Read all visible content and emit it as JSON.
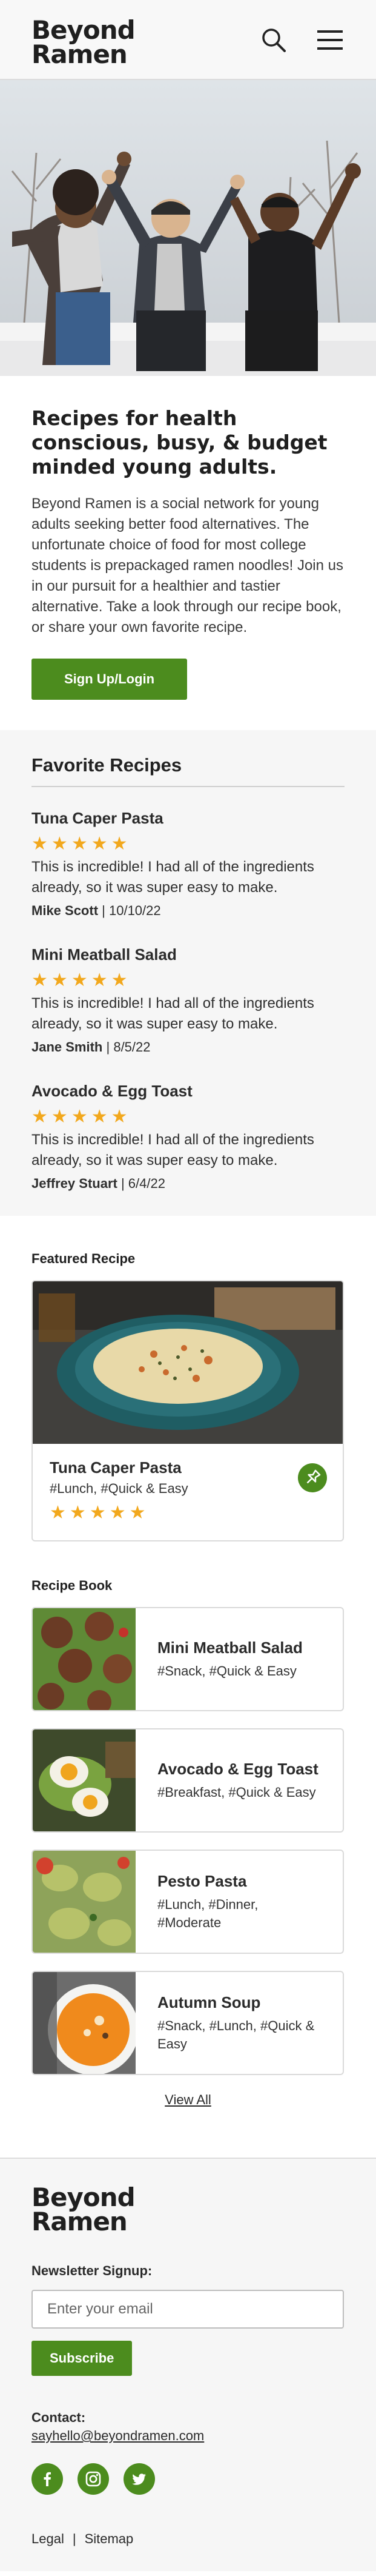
{
  "header": {
    "logo_line1": "Beyond",
    "logo_line2": "Ramen",
    "search_icon": "search-icon",
    "menu_icon": "hamburger-menu-icon"
  },
  "intro": {
    "heading": "Recipes for health conscious, busy, & budget minded young adults.",
    "body": "Beyond Ramen is a social network for young adults seeking better food alternatives. The unfortunate choice of food for most college students is prepackaged ramen noodles! Join us in our pursuit for a healthier and tastier alternative. Take a look through our recipe book, or share your own favorite recipe.",
    "cta_label": "Sign Up/Login"
  },
  "favorites": {
    "title": "Favorite Recipes",
    "reviews": [
      {
        "recipe": "Tuna Caper Pasta",
        "rating": 5,
        "text": "This is incredible! I had all of the ingredients already, so it was super easy to make.",
        "author": "Mike Scott",
        "date": "| 10/10/22"
      },
      {
        "recipe": "Mini Meatball Salad",
        "rating": 5,
        "text": "This is incredible! I had all of the ingredients already, so it was super easy to make.",
        "author": "Jane Smith",
        "date": "| 8/5/22"
      },
      {
        "recipe": "Avocado & Egg Toast",
        "rating": 5,
        "text": "This is incredible! I had all of the ingredients already, so it was super easy to make.",
        "author": "Jeffrey Stuart",
        "date": "| 6/4/22"
      }
    ]
  },
  "featured": {
    "title": "Featured Recipe",
    "name": "Tuna Caper Pasta",
    "tags": "#Lunch, #Quick & Easy",
    "rating": 5,
    "pin_icon": "pin-icon"
  },
  "book": {
    "title": "Recipe Book",
    "items": [
      {
        "name": "Mini Meatball Salad",
        "tags": "#Snack, #Quick & Easy"
      },
      {
        "name": "Avocado & Egg Toast",
        "tags": "#Breakfast, #Quick & Easy"
      },
      {
        "name": "Pesto Pasta",
        "tags": "#Lunch, #Dinner, #Moderate"
      },
      {
        "name": "Autumn Soup",
        "tags": "#Snack, #Lunch, #Quick & Easy"
      }
    ],
    "view_all": "View All"
  },
  "footer": {
    "logo_line1": "Beyond",
    "logo_line2": "Ramen",
    "newsletter_label": "Newsletter Signup:",
    "email_placeholder": "Enter your email",
    "subscribe_label": "Subscribe",
    "contact_label": "Contact:",
    "contact_email": "sayhello@beyondramen.com",
    "socials": [
      "facebook-icon",
      "instagram-icon",
      "twitter-icon"
    ],
    "legal": "Legal",
    "separator": "|",
    "sitemap": "Sitemap"
  },
  "colors": {
    "brand_green": "#4c8c1e",
    "star": "#f2a81d",
    "text_dark": "#1f1f1f"
  }
}
